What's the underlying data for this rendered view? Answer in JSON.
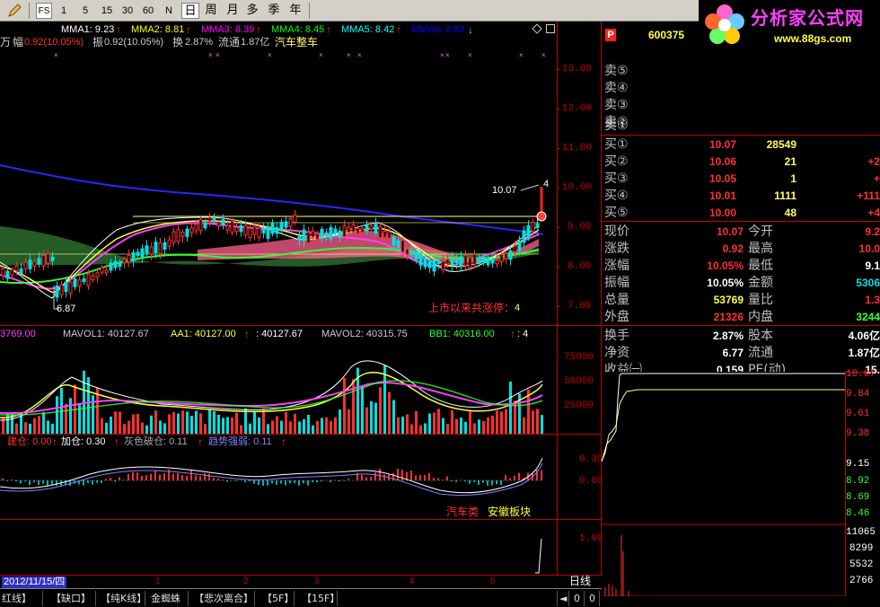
{
  "toolbar": {
    "buttons": [
      "1",
      "5",
      "15",
      "30",
      "60",
      "N",
      "日",
      "周",
      "月",
      "多",
      "季",
      "年"
    ],
    "fs_label": "FS"
  },
  "logo": {
    "title": "分析家公式网",
    "url": "www.88gs.com"
  },
  "ma_legend": [
    {
      "label": "MMA1: 9.23",
      "color": "#ffffff"
    },
    {
      "label": "MMA2: 8.81",
      "color": "#ffff00"
    },
    {
      "label": "MMA3: 8.39",
      "color": "#ff00ff"
    },
    {
      "label": "MMA4: 8.45",
      "color": "#00ff00"
    },
    {
      "label": "MMA5: 8.42",
      "color": "#00ffff"
    },
    {
      "label": "MMA6: 8.83",
      "color": "#0000ff"
    }
  ],
  "info_line": {
    "p1": "万",
    "p2": "幅",
    "p3": "0.92(10.05%)",
    "p4": "振",
    "p5": "0.92(10.05%)",
    "p6": "换",
    "p7": "2.87%",
    "p8": "流通",
    "p9": "1.87亿",
    "p10": "汽车整车"
  },
  "main_chart": {
    "price_labels": [
      "13.00",
      "12.00",
      "11.00",
      "10.00",
      "9.00",
      "8.00",
      "7.00"
    ],
    "high_marker": "10.07",
    "low_marker": "6.87",
    "limit_count_label": "上市以来共涨停：",
    "limit_count_value": "4",
    "peak_value": "4"
  },
  "volume_panel": {
    "v0": "3769.00",
    "mavol1": "MAVOL1: 40127.67",
    "aa1": "AA1: 40127.00",
    "x": ": 40127.67",
    "mavol2": "MAVOL2: 40315.75",
    "bb1": "BB1: 40316.00",
    "v4": ": 4",
    "labels": [
      "75000",
      "50000",
      "25000"
    ]
  },
  "indicator_panel": {
    "l1": "建仓: 0.00",
    "l2": "加仓: 0.30",
    "l3": "灰色破仓: 0.11",
    "l4": "趋势强弱: 0.11",
    "labels": [
      "0.30",
      "0.00"
    ],
    "sector1": "汽车类",
    "sector2": "安徽板块"
  },
  "extra_panel": {
    "label": "1.00"
  },
  "date_bar": {
    "date": "2012/11/15/四",
    "marks": [
      "1",
      "2",
      "3",
      "4",
      "5"
    ],
    "period": "日线"
  },
  "bottom_tabs": [
    "红线】",
    "【缺口】",
    "【纯K线】",
    "金蜘蛛",
    "【悲次离合】",
    "【5F】",
    "【15F】"
  ],
  "bottom_ctrl": [
    "◄",
    "0",
    "0"
  ],
  "quote": {
    "code": "600375",
    "flag": "P",
    "sells": [
      {
        "label": "卖⑤",
        "price": "",
        "vol": "",
        "chg": ""
      },
      {
        "label": "卖④",
        "price": "",
        "vol": "",
        "chg": ""
      },
      {
        "label": "卖③",
        "price": "",
        "vol": "",
        "chg": ""
      },
      {
        "label": "卖②",
        "price": "",
        "vol": "",
        "chg": ""
      },
      {
        "label": "卖①",
        "price": "",
        "vol": "",
        "chg": ""
      }
    ],
    "buys": [
      {
        "label": "买①",
        "price": "10.07",
        "vol": "28549",
        "chg": ""
      },
      {
        "label": "买②",
        "price": "10.06",
        "vol": "21",
        "chg": "+2"
      },
      {
        "label": "买③",
        "price": "10.05",
        "vol": "1",
        "chg": "+"
      },
      {
        "label": "买④",
        "price": "10.01",
        "vol": "1111",
        "chg": "+111"
      },
      {
        "label": "买⑤",
        "price": "10.00",
        "vol": "48",
        "chg": "+4"
      }
    ],
    "stats": [
      {
        "l1": "现价",
        "v1": "10.07",
        "c1": "red",
        "l2": "今开",
        "v2": "9.2",
        "c2": "red"
      },
      {
        "l1": "涨跌",
        "v1": "0.92",
        "c1": "red",
        "l2": "最高",
        "v2": "10.0",
        "c2": "red"
      },
      {
        "l1": "涨幅",
        "v1": "10.05%",
        "c1": "red",
        "l2": "最低",
        "v2": "9.1",
        "c2": "wht"
      },
      {
        "l1": "振幅",
        "v1": "10.05%",
        "c1": "wht",
        "l2": "金额",
        "v2": "5306",
        "c2": "cya"
      },
      {
        "l1": "总量",
        "v1": "53769",
        "c1": "yel",
        "l2": "量比",
        "v2": "1.3",
        "c2": "red"
      },
      {
        "l1": "外盘",
        "v1": "21326",
        "c1": "red",
        "l2": "内盘",
        "v2": "3244",
        "c2": "grn"
      }
    ],
    "stats2": [
      {
        "l1": "换手",
        "v1": "2.87%",
        "c1": "wht",
        "l2": "股本",
        "v2": "4.06亿",
        "c2": "wht"
      },
      {
        "l1": "净资",
        "v1": "6.77",
        "c1": "wht",
        "l2": "流通",
        "v2": "1.87亿",
        "c2": "wht"
      },
      {
        "l1": "收益㈠",
        "v1": "0.159",
        "c1": "wht",
        "l2": "PE(动)",
        "v2": "15.",
        "c2": "wht"
      }
    ]
  },
  "mini_chart": {
    "price_labels": [
      "10.07",
      "9.84",
      "9.61",
      "9.38",
      "9.15",
      "8.92",
      "8.69",
      "8.46"
    ],
    "vol_labels": [
      "11065",
      "8299",
      "5532",
      "2766"
    ]
  },
  "colors": {
    "up": "#ff3030",
    "down": "#00e0e0",
    "axis": "#c00000"
  }
}
